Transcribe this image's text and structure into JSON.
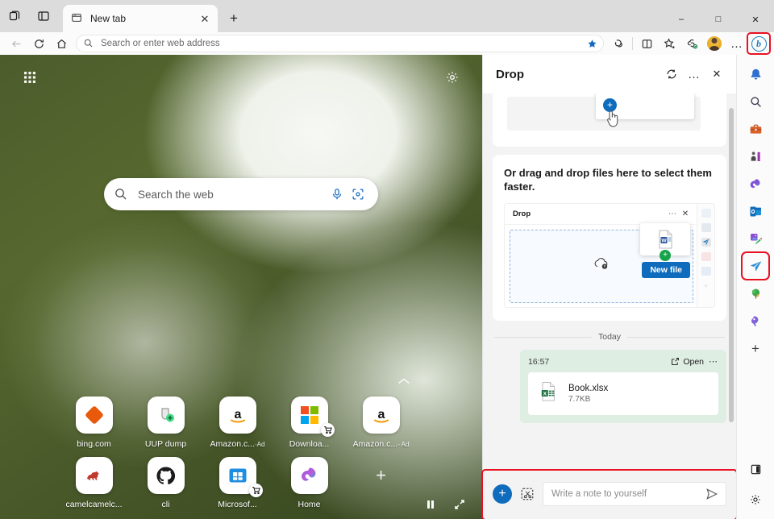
{
  "window": {
    "controls": {
      "minimize": "–",
      "maximize": "□",
      "close": "✕"
    }
  },
  "tabbar": {
    "workspaces_icon": "workspaces-icon",
    "tab_actions_icon": "tab-actions-icon",
    "tabs": [
      {
        "title": "New tab",
        "favicon": "newtab-icon",
        "close_label": "✕"
      }
    ],
    "new_tab_label": "+"
  },
  "navbar": {
    "back_label": "←",
    "refresh_label": "⟳",
    "home_label": "home-icon",
    "omnibox": {
      "placeholder": "Search or enter web address",
      "value": "",
      "search_icon": "search-icon",
      "favorite_icon": "star-filled-icon"
    },
    "buttons": [
      {
        "name": "copilot-mode-icon"
      },
      {
        "name": "split-screen-icon"
      },
      {
        "name": "add-favorite-icon"
      },
      {
        "name": "collections-icon"
      },
      {
        "name": "profile-avatar"
      },
      {
        "name": "settings-and-more-icon",
        "label": "…"
      }
    ],
    "copilot_button": {
      "name": "copilot-button",
      "glyph": "b",
      "highlighted": true
    }
  },
  "newtab": {
    "grid_icon": "app-grid-icon",
    "settings_icon": "page-settings-gear-icon",
    "search": {
      "placeholder": "Search the web",
      "value": "",
      "search_icon": "search-icon",
      "mic_icon": "microphone-icon",
      "lens_icon": "visual-search-icon"
    },
    "expand_chevron": "chevron-up-icon",
    "shortcuts": [
      {
        "label": "bing.com",
        "icon": "bing-icon",
        "ad": false,
        "cart": false
      },
      {
        "label": "UUP dump",
        "icon": "uupdump-icon",
        "ad": false,
        "cart": false
      },
      {
        "label": "Amazon.c...",
        "icon": "amazon-icon",
        "ad": true,
        "ad_label": "·Ad",
        "cart": false
      },
      {
        "label": "Downloa...",
        "icon": "microsoft-icon",
        "ad": false,
        "cart": true
      },
      {
        "label": "Amazon.c...",
        "icon": "amazon-icon",
        "ad": true,
        "ad_label": "- Ad",
        "cart": false
      },
      {
        "label": "camelcamelc...",
        "icon": "camel-icon",
        "ad": false,
        "cart": false
      },
      {
        "label": "cli",
        "icon": "github-icon",
        "ad": false,
        "cart": false
      },
      {
        "label": "Microsof...",
        "icon": "microsoft-store-icon",
        "ad": false,
        "cart": true
      },
      {
        "label": "Home",
        "icon": "copilot-home-icon",
        "ad": false,
        "cart": false
      }
    ],
    "add_shortcut_label": "+",
    "media_pause_icon": "pause-icon",
    "media_expand_icon": "expand-icon"
  },
  "drop": {
    "title": "Drop",
    "header_buttons": [
      {
        "name": "refresh-icon",
        "label": "⟳"
      },
      {
        "name": "more-options-icon",
        "label": "…"
      },
      {
        "name": "close-panel-icon",
        "label": "✕"
      }
    ],
    "promo": {
      "plus_label": "+",
      "text": "Or drag and drop files here to select them faster.",
      "illustration": {
        "title": "Drop",
        "more_label": "⋯",
        "close_label": "✕",
        "new_file_button": "New file",
        "green_plus": "+",
        "cloud_icon": "cloud-upload-icon",
        "word_file_icon": "word-document-icon"
      }
    },
    "divider_label": "Today",
    "messages": [
      {
        "time": "16:57",
        "open_label": "Open",
        "open_icon": "open-external-icon",
        "more_label": "⋯",
        "file": {
          "name": "Book.xlsx",
          "size": "7.7KB",
          "icon": "excel-file-icon"
        }
      }
    ],
    "composer": {
      "add_label": "+",
      "snip_icon": "screenshot-icon",
      "placeholder": "Write a note to yourself",
      "value": "",
      "send_icon": "send-icon",
      "highlighted": true
    }
  },
  "sidebar": {
    "items": [
      {
        "name": "notifications-icon",
        "label": "Notifications"
      },
      {
        "name": "search-icon",
        "label": "Search"
      },
      {
        "name": "tools-icon",
        "label": "Tools"
      },
      {
        "name": "games-icon",
        "label": "Games"
      },
      {
        "name": "copilot-icon",
        "label": "Copilot"
      },
      {
        "name": "outlook-icon",
        "label": "Outlook"
      },
      {
        "name": "designer-icon",
        "label": "Designer"
      },
      {
        "name": "drop-icon",
        "label": "Drop",
        "active": true,
        "highlighted": true
      },
      {
        "name": "shopping-icon",
        "label": "Shopping"
      },
      {
        "name": "vpn-icon",
        "label": "VPN"
      },
      {
        "name": "add-sidebar-app-icon",
        "label": "+"
      }
    ],
    "bottom": [
      {
        "name": "toggle-sidebar-icon",
        "label": "Customize"
      },
      {
        "name": "sidebar-settings-gear-icon",
        "label": "Settings"
      }
    ]
  },
  "colors": {
    "accent_blue": "#0f6cbd",
    "highlight_red": "#e81123",
    "bubble_green": "#dfeee3",
    "excel_green": "#217346"
  }
}
